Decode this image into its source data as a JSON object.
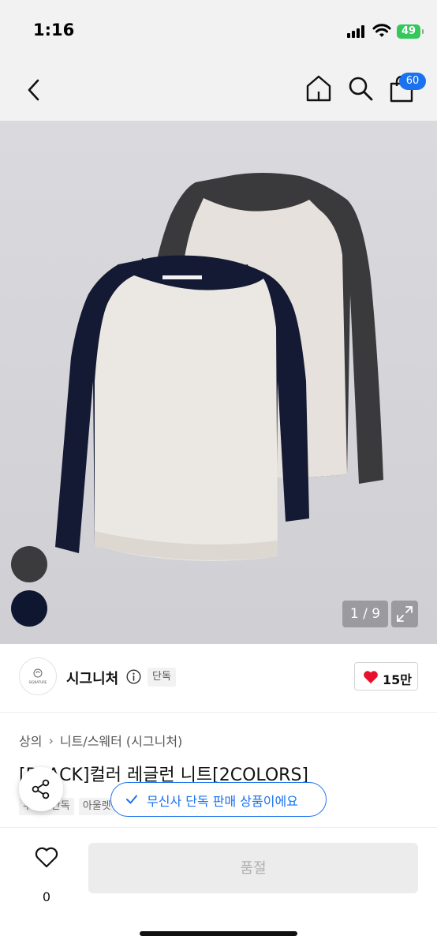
{
  "status_bar": {
    "time": "1:16",
    "battery": "49"
  },
  "nav": {
    "cart_count": "60"
  },
  "product_image": {
    "page_indicator": "1 / 9"
  },
  "brand": {
    "name": "시그니처",
    "logo_text": "SIGNATURE",
    "exclusive_tag": "단독",
    "likes": "15만"
  },
  "breadcrumb": {
    "category": "상의",
    "subcategory": "니트/스웨터 (시그니처)"
  },
  "product": {
    "title": "[BLACK]컬러 레글런 니트[2COLORS]",
    "tags": [
      "무신사단독",
      "아울렛"
    ]
  },
  "toast": {
    "text": "무신사 단독 판매 상품이에요"
  },
  "bottom_bar": {
    "wish_count": "0",
    "soldout_label": "품절"
  },
  "colors": {
    "accent": "#1a72f0",
    "heart": "#e8112d",
    "battery": "#34c759"
  }
}
